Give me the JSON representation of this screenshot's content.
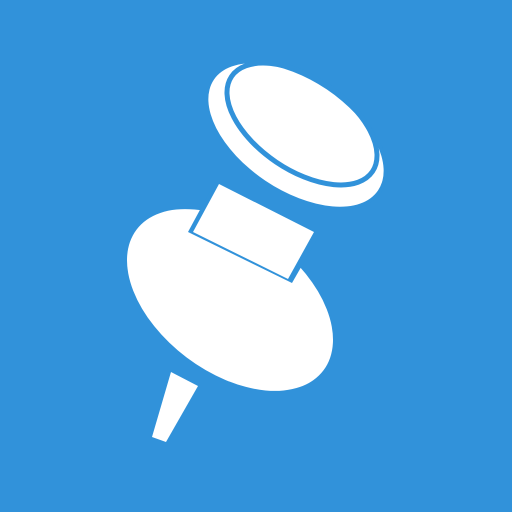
{
  "tile": {
    "icon": "pushpin-icon",
    "background_color": "#3192da",
    "icon_color": "#ffffff"
  }
}
